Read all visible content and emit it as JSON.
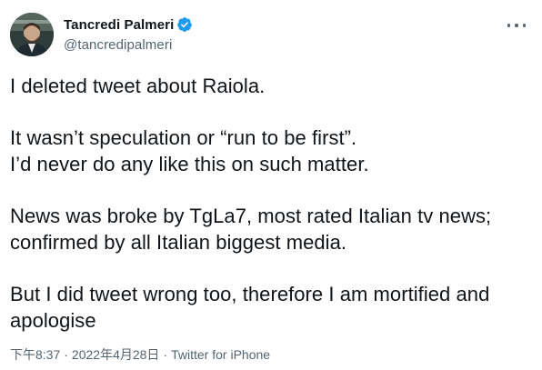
{
  "author": {
    "display_name": "Tancredi Palmeri",
    "handle": "@tancredipalmeri",
    "verified": true
  },
  "tweet": {
    "paragraphs": [
      [
        "I deleted tweet about Raiola."
      ],
      [
        "It wasn’t speculation or “run to be first”.",
        "I’d never do any like this on such matter."
      ],
      [
        "News was broke by TgLa7, most rated Italian tv news;",
        "confirmed by all Italian biggest media."
      ],
      [
        "But I did tweet wrong too, therefore I am mortified and",
        "apologise"
      ]
    ]
  },
  "meta": {
    "time": "下午8:37",
    "separator": "·",
    "date": "2022年4月28日",
    "source": "Twitter for iPhone"
  },
  "colors": {
    "text": "#0f1419",
    "secondary": "#536471",
    "verified": "#1d9bf0"
  },
  "icons": {
    "verified": "verified-badge-icon",
    "more": "more-options-icon"
  }
}
